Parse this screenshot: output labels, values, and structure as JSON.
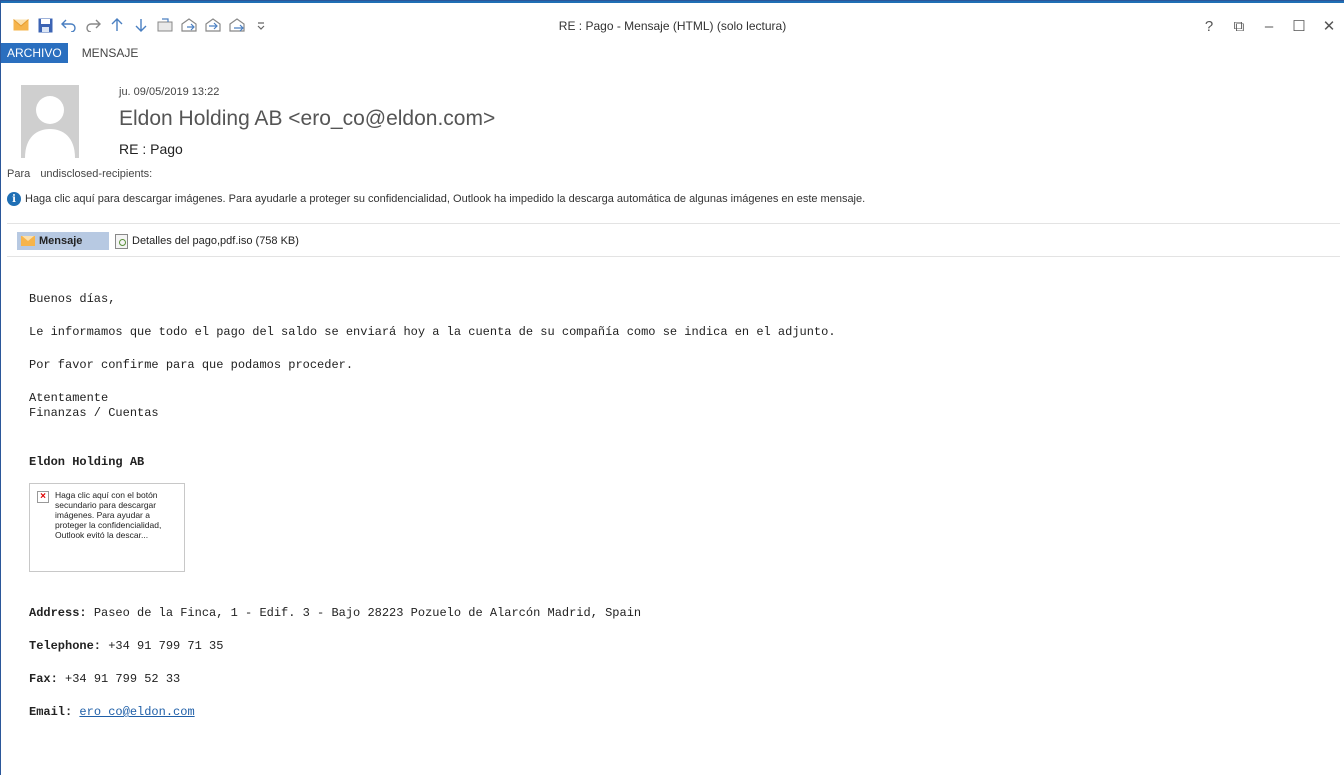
{
  "window": {
    "title": "RE : Pago - Mensaje (HTML) (solo lectura)",
    "controls": [
      "?",
      "⧉",
      "–",
      "☐",
      "✕"
    ]
  },
  "quick_access": [
    "envelope-icon",
    "save-icon",
    "undo-icon",
    "redo-icon",
    "up-arrow-icon",
    "down-arrow-icon",
    "move-icon",
    "reply-icon",
    "reply-all-icon",
    "forward-icon",
    "customize-icon"
  ],
  "ribbon": {
    "tabs": [
      "ARCHIVO",
      "MENSAJE"
    ],
    "active_color": "#2a6fbf"
  },
  "header": {
    "date": "ju. 09/05/2019 13:22",
    "sender": "Eldon Holding AB <ero_co@eldon.com>",
    "subject": "RE : Pago",
    "to_label": "Para",
    "to_value": "undisclosed-recipients:",
    "info_text": "Haga clic aquí para descargar imágenes. Para ayudarle a proteger su confidencialidad, Outlook ha impedido la descarga automática de algunas imágenes en este mensaje."
  },
  "attachments": {
    "message_label": "Mensaje",
    "file": "Detalles del pago,pdf.iso (758 KB)"
  },
  "body": {
    "greeting": "Buenos días,",
    "line1": "Le informamos que todo el pago del saldo se enviará hoy a la cuenta de su compañía como se indica en el adjunto.",
    "line2": "Por favor confirme para que podamos proceder.",
    "closing1": "Atentamente",
    "closing2": "Finanzas / Cuentas",
    "company": "Eldon Holding AB",
    "image_placeholder": "Haga clic aquí con el botón secundario para descargar imágenes. Para ayudar a proteger la confidencialidad, Outlook evitó la descar...",
    "address_label": "Address:",
    "address": "Paseo de la Finca, 1 - Edif. 3 - Bajo 28223 Pozuelo de Alarcón Madrid, Spain",
    "telephone_label": "Telephone:",
    "telephone": "+34 91 799 71 35",
    "fax_label": "Fax:",
    "fax": "+34 91 799 52 33",
    "email_label": "Email:",
    "email": "ero co@eldon.com"
  }
}
